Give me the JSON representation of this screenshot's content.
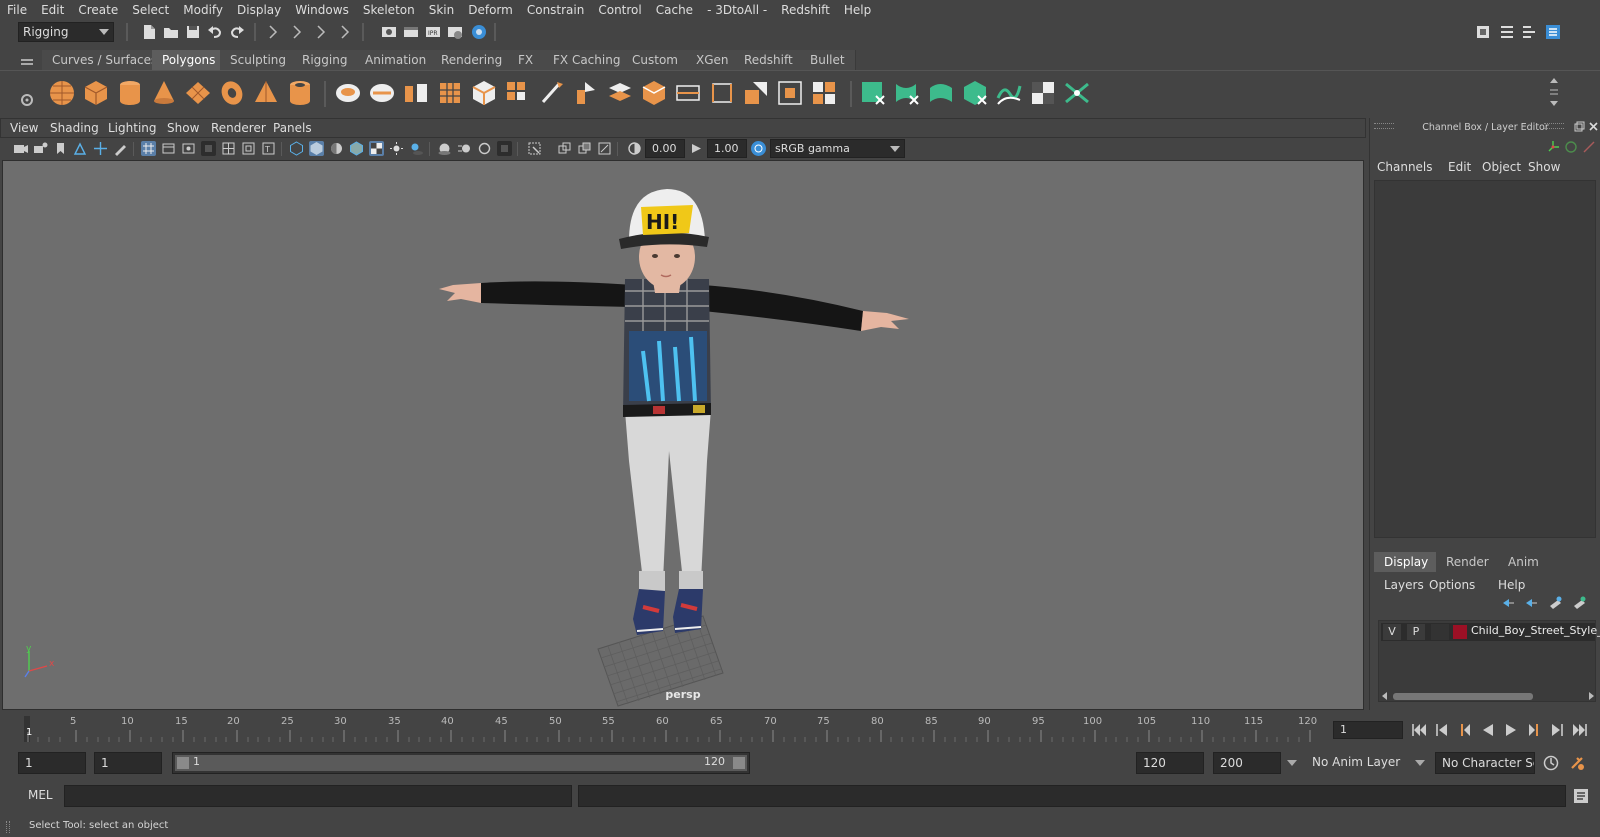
{
  "menubar": {
    "items": [
      "File",
      "Edit",
      "Create",
      "Select",
      "Modify",
      "Display",
      "Windows",
      "Skeleton",
      "Skin",
      "Deform",
      "Constrain",
      "Control",
      "Cache",
      "- 3DtoAll -",
      "Redshift",
      "Help"
    ]
  },
  "statusline": {
    "menuset": "Rigging"
  },
  "shelf": {
    "tabs": [
      "Curves / Surfaces",
      "Polygons",
      "Sculpting",
      "Rigging",
      "Animation",
      "Rendering",
      "FX",
      "FX Caching",
      "Custom",
      "XGen",
      "Redshift",
      "Bullet"
    ],
    "active_tab": "Polygons"
  },
  "viewport": {
    "menu": [
      "View",
      "Shading",
      "Lighting",
      "Show",
      "Renderer",
      "Panels"
    ],
    "exposure": "0.00",
    "gamma": "1.00",
    "color_space": "sRGB gamma",
    "camera_label": "persp",
    "axis_y": "y",
    "axis_x": "x"
  },
  "right_panel": {
    "title": "Channel Box / Layer Editor",
    "cb_menu": [
      "Channels",
      "Edit",
      "Object",
      "Show"
    ],
    "tabs": [
      "Display",
      "Render",
      "Anim"
    ],
    "active_tab": "Display",
    "layer_menu": [
      "Layers",
      "Options",
      "Help"
    ],
    "layer": {
      "v": "V",
      "p": "P",
      "color": "#9b1025",
      "name": "Child_Boy_Street_Style_T"
    }
  },
  "timeline": {
    "ticks": [
      "5",
      "10",
      "15",
      "20",
      "25",
      "30",
      "35",
      "40",
      "45",
      "50",
      "55",
      "60",
      "65",
      "70",
      "75",
      "80",
      "85",
      "90",
      "95",
      "100",
      "105",
      "110",
      "115",
      "120"
    ],
    "current_marker": "1",
    "current_frame": "1"
  },
  "range": {
    "start_time": "1",
    "playback_start": "1",
    "slider_start": "1",
    "slider_end": "120",
    "playback_end": "120",
    "end_time": "200",
    "anim_layer": "No Anim Layer",
    "character_set": "No Character Set"
  },
  "command": {
    "lang": "MEL"
  },
  "help_line": {
    "text": "Select Tool: select an object"
  },
  "colors": {
    "shelf_poly": "#e8944a",
    "shelf_green": "#3dbb8c",
    "accent_blue": "#3a8ed6"
  }
}
